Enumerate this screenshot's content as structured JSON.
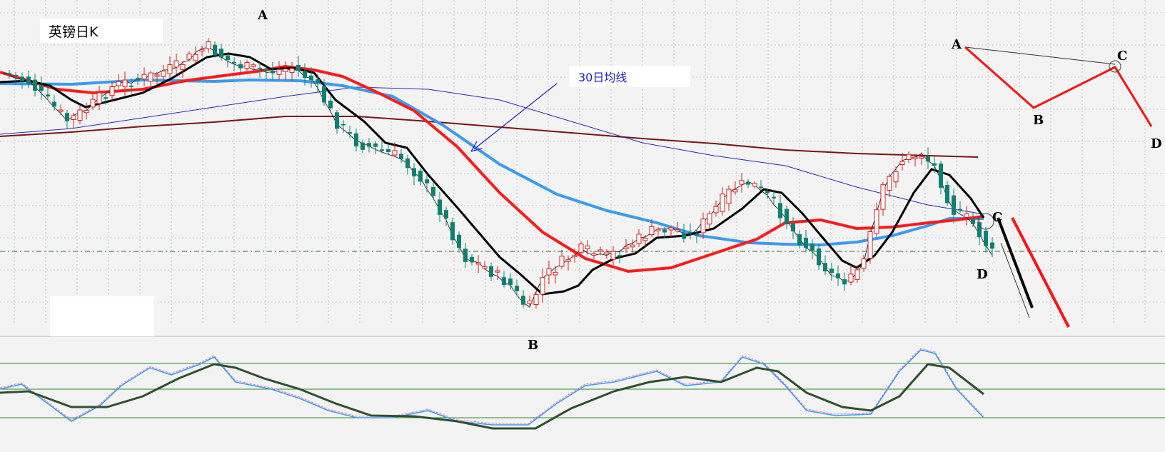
{
  "chart_data": {
    "type": "candlestick",
    "title": "英镑日K",
    "annotations": {
      "ma_label": "30日均线",
      "points": [
        "A",
        "B",
        "C",
        "D"
      ]
    },
    "schematic_points": [
      "A",
      "B",
      "C",
      "D"
    ],
    "colors": {
      "up": "#dd1e1e",
      "down": "#0f8070",
      "ma_fast": "#000000",
      "ma_30": "#ff1a1a",
      "ma_mid": "#3a9bef",
      "ma_slow_blue": "#2a2ab0",
      "ma_long": "#7a1515",
      "osc_main": "#2f4f2f",
      "osc_fast": "#3a9bef"
    }
  }
}
